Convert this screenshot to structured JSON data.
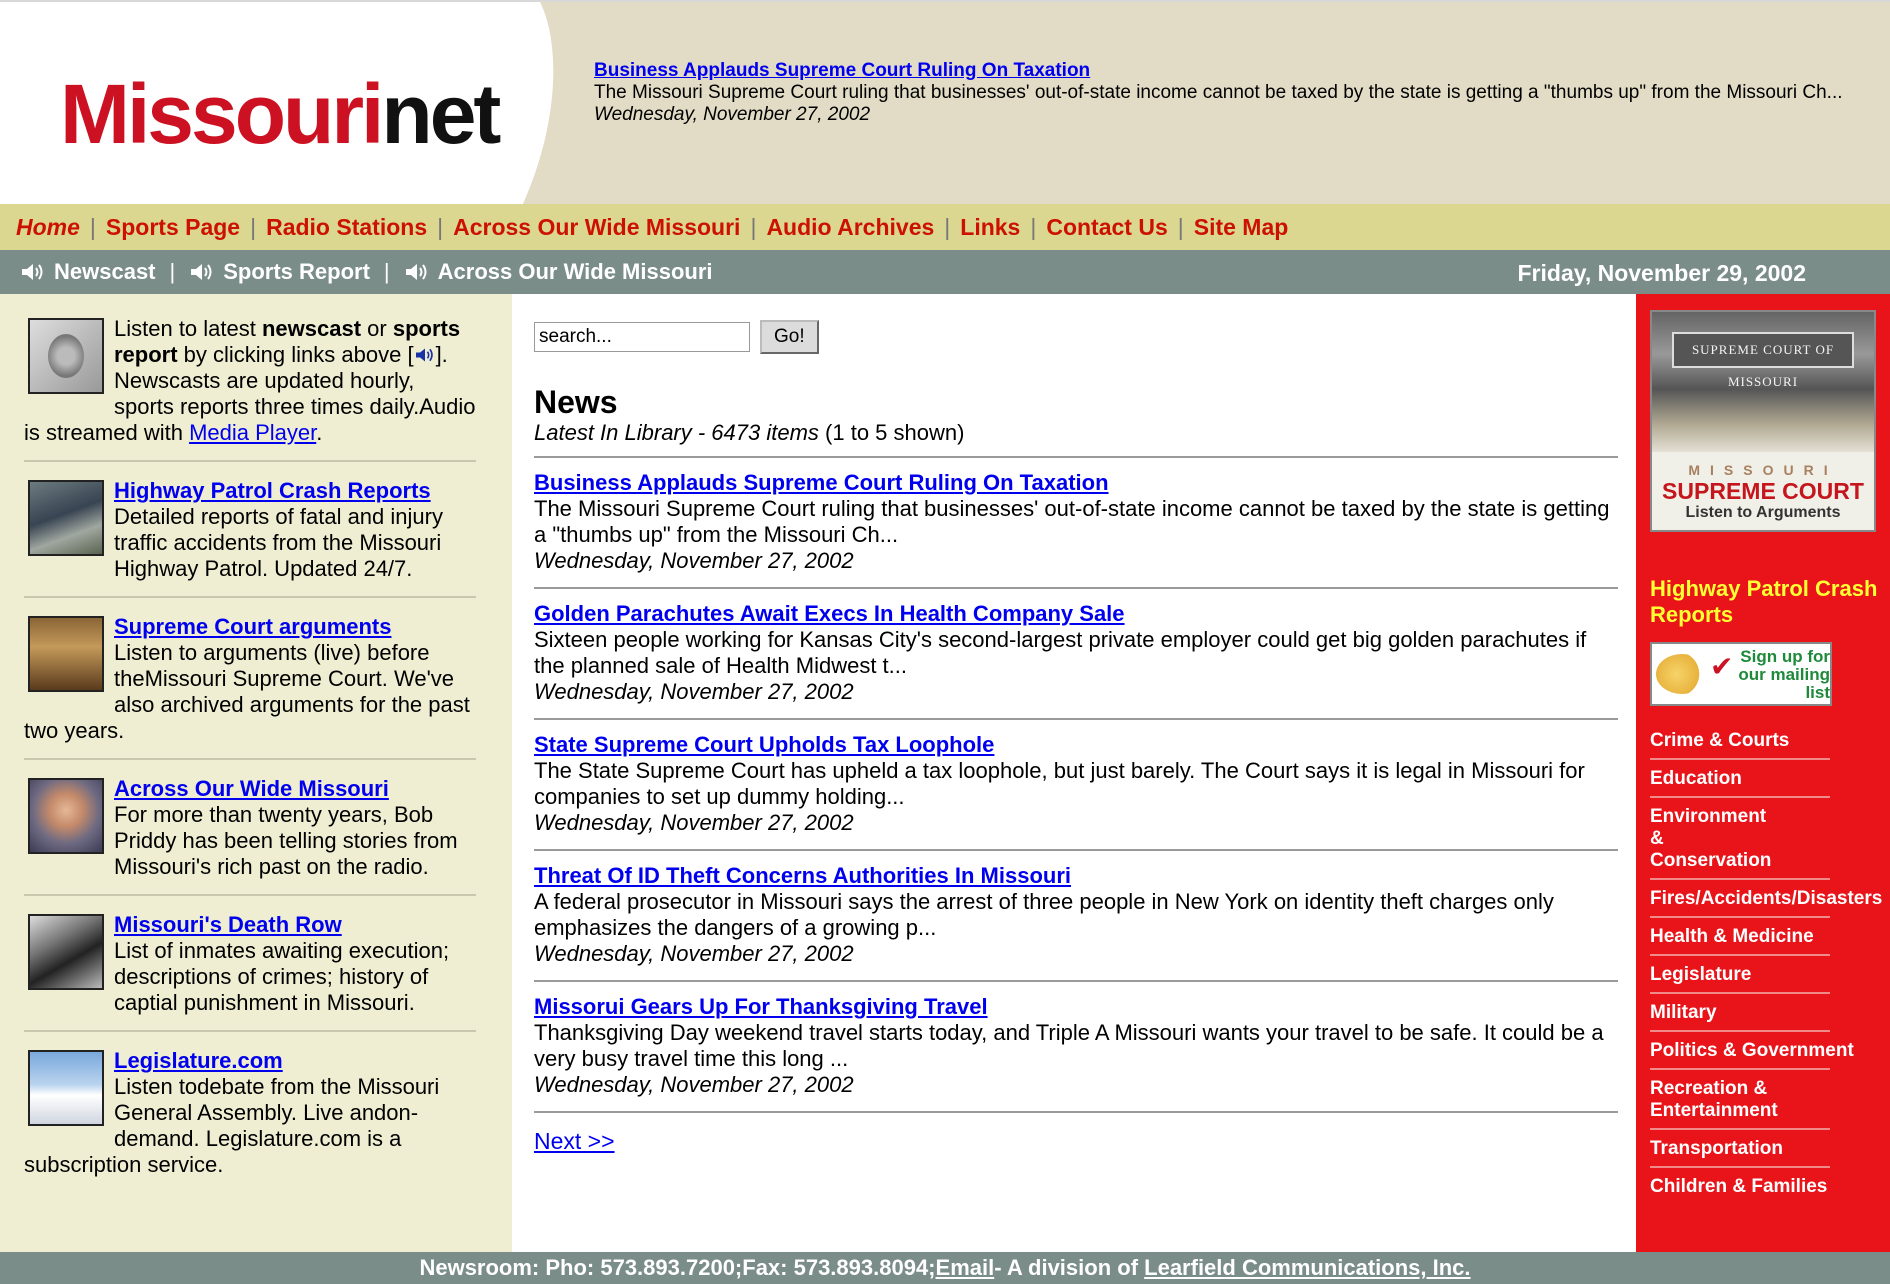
{
  "logo": {
    "part1": "Missouri",
    "part2": "net"
  },
  "headline": {
    "title": "Business Applauds Supreme Court Ruling On Taxation",
    "summary": "The Missouri Supreme Court ruling that businesses' out-of-state income cannot be taxed by the state is getting a \"thumbs up\" from the Missouri Ch...",
    "date": "Wednesday, November 27, 2002"
  },
  "main_nav": [
    "Home",
    "Sports Page",
    "Radio Stations",
    "Across Our Wide Missouri",
    "Audio Archives",
    "Links",
    "Contact Us",
    "Site Map"
  ],
  "audio_bar": {
    "links": [
      "Newscast",
      "Sports Report",
      "Across Our Wide Missouri"
    ],
    "date": "Friday, November 29, 2002"
  },
  "left": {
    "intro": {
      "t1": "Listen to latest ",
      "b1": "newscast",
      "t2": " or ",
      "b2": "sports report",
      "t3": " by clicking links above [",
      "t4": "]. Newscasts are updated hourly, sports reports three times daily.Audio is streamed with ",
      "link": "Media Player",
      "t5": "."
    },
    "entries": [
      {
        "title": "Highway Patrol Crash Reports",
        "desc": "Detailed reports of fatal and injury traffic accidents from the Missouri Highway Patrol. Updated 24/7."
      },
      {
        "title": "Supreme Court arguments",
        "desc": "Listen to arguments (live) before theMissouri Supreme Court. We've also archived arguments for the past two years."
      },
      {
        "title": "Across Our Wide Missouri",
        "desc": "For more than twenty years, Bob Priddy has been telling stories from Missouri's rich past on the radio."
      },
      {
        "title": "Missouri's Death Row",
        "desc": "List of inmates awaiting execution; descriptions of crimes; history of captial punishment in Missouri."
      },
      {
        "title": "Legislature.com",
        "desc": "Listen todebate from the Missouri General Assembly. Live andon-demand. Legislature.com is a subscription service."
      }
    ]
  },
  "search": {
    "placeholder": "search...",
    "button": "Go!"
  },
  "news": {
    "title": "News",
    "library": "Latest In Library - 6473 items",
    "shown": " (1 to 5 shown)",
    "items": [
      {
        "title": "Business Applauds Supreme Court Ruling On Taxation",
        "summary": "The Missouri Supreme Court ruling that businesses' out-of-state income cannot be taxed by the state is getting a \"thumbs up\" from the Missouri Ch...",
        "date": "Wednesday, November 27, 2002"
      },
      {
        "title": "Golden Parachutes Await Execs In Health Company Sale",
        "summary": "Sixteen people working for Kansas City's second-largest private employer could get big golden parachutes if the planned sale of Health Midwest t...",
        "date": "Wednesday, November 27, 2002"
      },
      {
        "title": "State Supreme Court Upholds Tax Loophole",
        "summary": "The State Supreme Court has upheld a tax loophole, but just barely. The Court says it is legal in Missouri for companies to set up dummy holding...",
        "date": "Wednesday, November 27, 2002"
      },
      {
        "title": "Threat Of ID Theft Concerns Authorities In Missouri",
        "summary": "A federal prosecutor in Missouri says the arrest of three people in New York on identity theft charges only emphasizes the dangers of a growing p...",
        "date": "Wednesday, November 27, 2002"
      },
      {
        "title": "Missorui Gears Up For Thanksgiving Travel",
        "summary": "Thanksgiving Day weekend travel starts today, and Triple A Missouri wants your travel to be safe. It could be a very busy travel time this long ...",
        "date": "Wednesday, November 27, 2002"
      }
    ],
    "next": "Next >>"
  },
  "right": {
    "banner": {
      "sign": "SUPREME COURT OF MISSOURI",
      "line1": "MISSOURI",
      "line2": "SUPREME COURT",
      "line3": "Listen to Arguments"
    },
    "crash_link": "Highway Patrol Crash Reports",
    "mailing": "Sign up for our mailing list",
    "sections": [
      "Crime & Courts",
      "Education",
      "Environment & Conservation",
      "Fires/Accidents/Disasters",
      "Health & Medicine",
      "Legislature",
      "Military",
      "Politics & Government",
      "Recreation & Entertainment",
      "Transportation",
      "Children & Families"
    ]
  },
  "footer": {
    "text1": "Newsroom: Pho: 573.893.7200;Fax: 573.893.8094;",
    "email": "Email",
    "text2": "- A division of ",
    "company": "Learfield Communications, Inc."
  },
  "colors": {
    "brand_red": "#cc1122",
    "nav_bg": "#dbd790",
    "bar_bg": "#7b8d89",
    "left_bg": "#efeed2",
    "right_bg": "#e8141a"
  }
}
